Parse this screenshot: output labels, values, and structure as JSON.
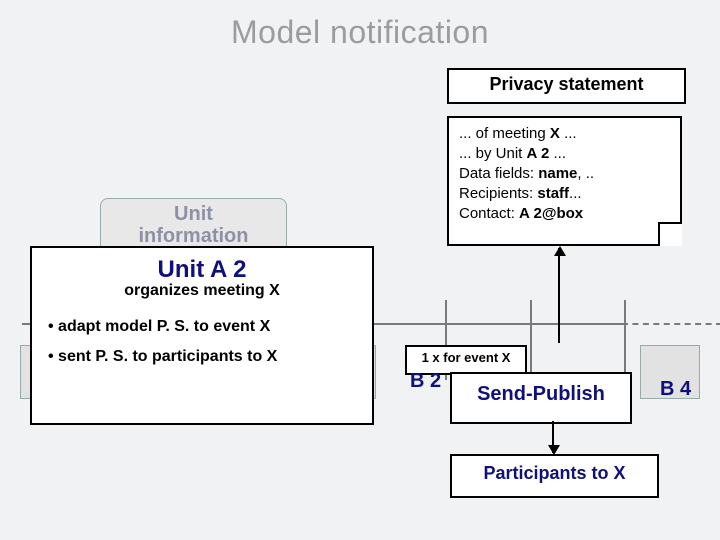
{
  "title": "Model notification",
  "privacy_label": "Privacy statement",
  "note": {
    "l1a": "... of meeting ",
    "l1b": "X",
    "l1c": " ...",
    "l2a": "... by Unit ",
    "l2b": "A 2",
    "l2c": " ...",
    "l3a": "Data fields: ",
    "l3b": "name",
    "l3c": ", ..",
    "l4a": "Recipients: ",
    "l4b": "staff",
    "l4c": "...",
    "l5a": "Contact: ",
    "l5b": "A 2@box"
  },
  "ghost": {
    "l1": "Unit",
    "l2": "information"
  },
  "unitA2": {
    "hdr": "Unit A 2",
    "sub": "organizes meeting X",
    "bullet1": "• adapt model P. S. to event  X",
    "bullet2": "• sent P. S. to participants to X"
  },
  "event_box": "1 x for event X",
  "b2": "B 2",
  "b4": "B 4",
  "send": "Send-Publish",
  "participants": "Participants to X"
}
